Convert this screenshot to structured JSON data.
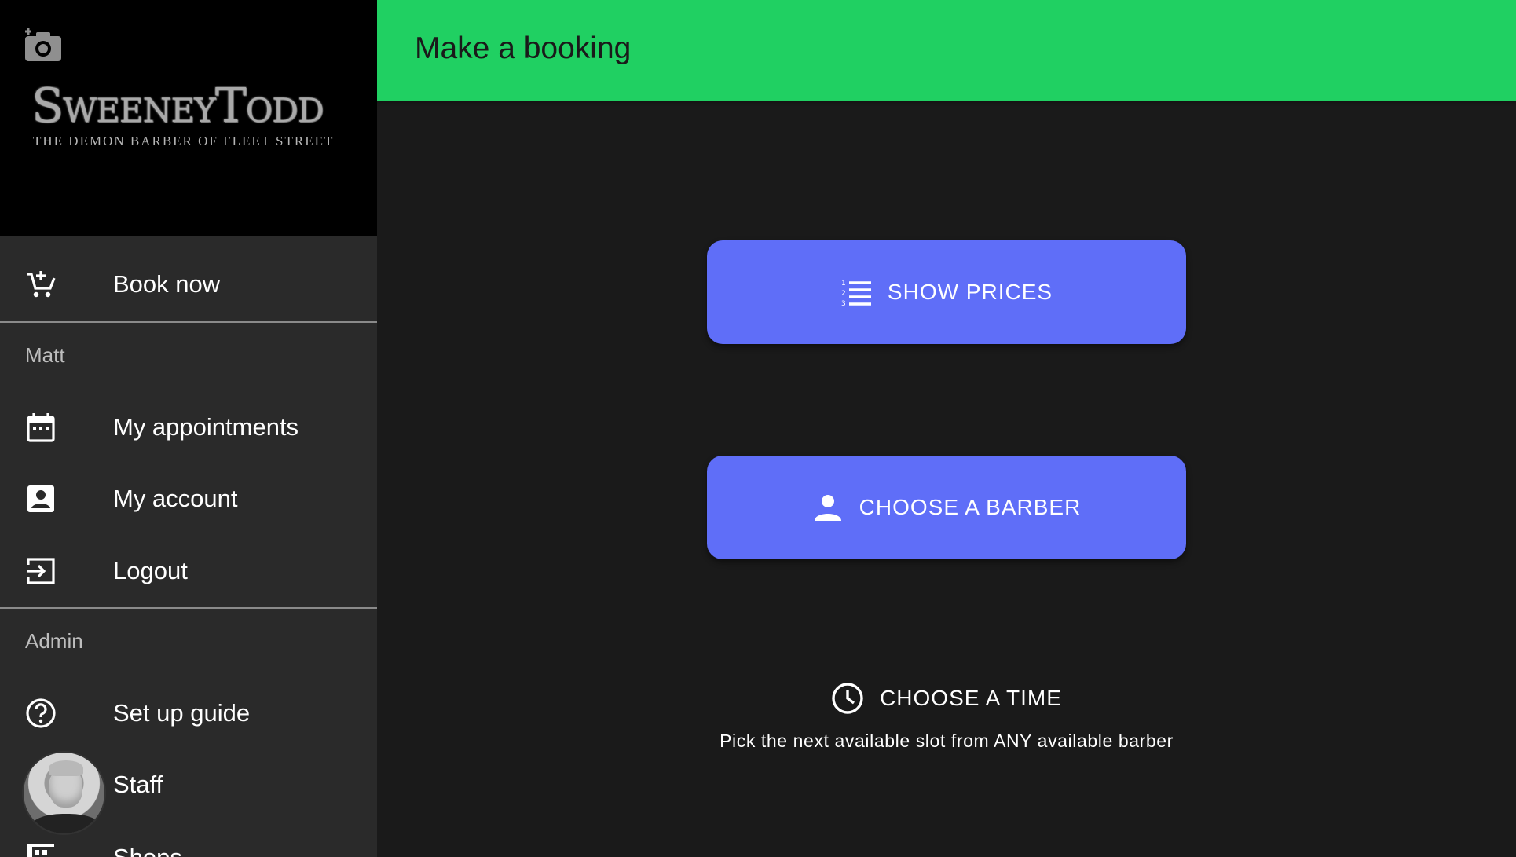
{
  "appbar": {
    "title": "Make a booking",
    "color": "#20d062"
  },
  "logo": {
    "title": "SweeneyTodd",
    "subtitle": "THE DEMON BARBER OF FLEET STREET"
  },
  "sidebar": {
    "book_now": {
      "label": "Book now",
      "icon": "add-shopping-cart-icon"
    },
    "user_section": "Matt",
    "user_items": [
      {
        "label": "My appointments",
        "icon": "calendar-icon"
      },
      {
        "label": "My account",
        "icon": "account-box-icon"
      },
      {
        "label": "Logout",
        "icon": "exit-icon"
      }
    ],
    "admin_section": "Admin",
    "admin_items": [
      {
        "label": "Set up guide",
        "icon": "help-circle-icon"
      },
      {
        "label": "Staff",
        "icon": "avatar"
      },
      {
        "label": "Shops",
        "icon": "store-icon"
      }
    ]
  },
  "main": {
    "show_prices": {
      "label": "SHOW PRICES",
      "icon": "numbered-list-icon"
    },
    "choose_barber": {
      "label": "CHOOSE A BARBER",
      "icon": "person-icon"
    },
    "choose_time": {
      "label": "CHOOSE A TIME",
      "icon": "clock-icon",
      "description": "Pick the next available slot from ANY available barber"
    },
    "button_color": "#5f6ef8"
  }
}
